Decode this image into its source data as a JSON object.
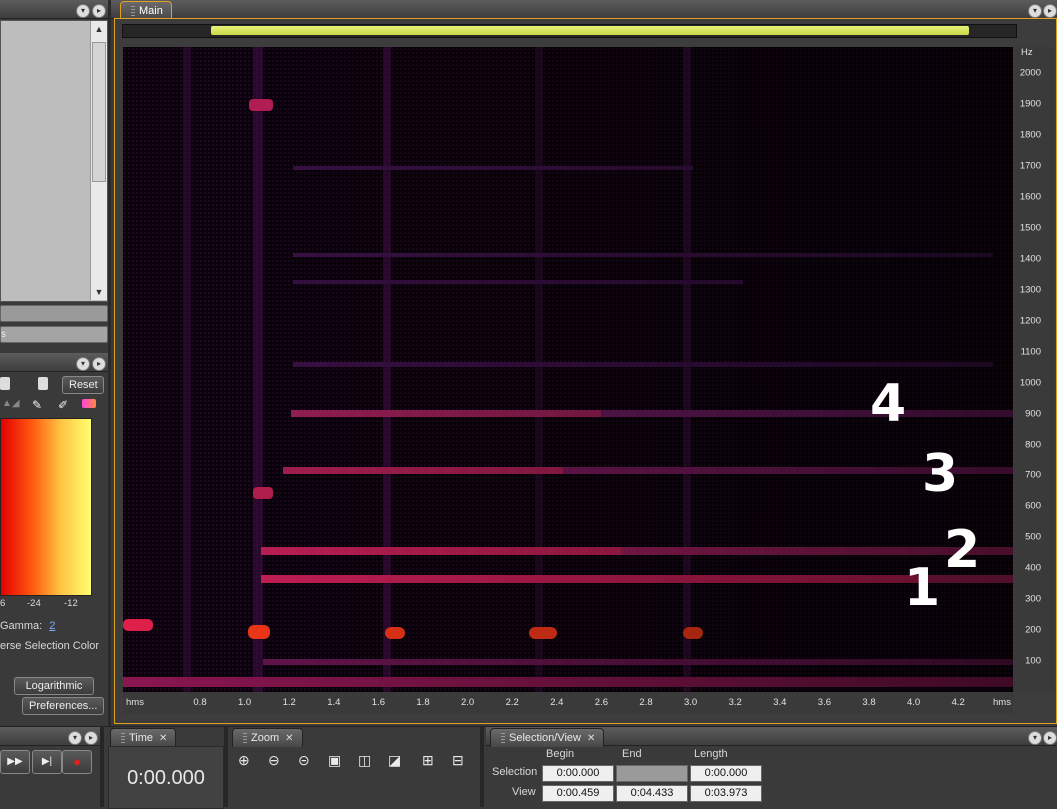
{
  "tabs": {
    "main": "Main",
    "time": "Time",
    "zoom": "Zoom",
    "selection_view": "Selection/View"
  },
  "left_panel": {
    "reset_label": "Reset",
    "db_ticks": [
      "6",
      "-24",
      "-12"
    ],
    "gamma_label": "Gamma:",
    "gamma_value": "2",
    "inverse_selection_label": "erse Selection Color",
    "logarithmic_label": "Logarithmic",
    "preferences_label": "Preferences...",
    "list_item_fragment": "s"
  },
  "spectrogram": {
    "hz_unit": "Hz",
    "hz_ticks": [
      "2000",
      "1900",
      "1800",
      "1700",
      "1600",
      "1500",
      "1400",
      "1300",
      "1200",
      "1100",
      "1000",
      "900",
      "800",
      "700",
      "600",
      "500",
      "400",
      "300",
      "200",
      "100"
    ],
    "hz_values": [
      2000,
      1900,
      1800,
      1700,
      1600,
      1500,
      1400,
      1300,
      1200,
      1100,
      1000,
      900,
      800,
      700,
      600,
      500,
      400,
      300,
      200,
      100
    ],
    "time_unit": "hms",
    "time_ticks": [
      "0.8",
      "1.0",
      "1.2",
      "1.4",
      "1.6",
      "1.8",
      "2.0",
      "2.2",
      "2.4",
      "2.6",
      "2.8",
      "3.0",
      "3.2",
      "3.4",
      "3.6",
      "3.8",
      "4.0",
      "4.2"
    ],
    "annotations": [
      "4",
      "3",
      "2",
      "1"
    ]
  },
  "time_panel": {
    "display": "0:00.000"
  },
  "selection_view": {
    "headers": [
      "Begin",
      "End",
      "Length"
    ],
    "selection_label": "Selection",
    "view_label": "View",
    "selection": [
      "0:00.000",
      "",
      "0:00.000"
    ],
    "view": [
      "0:00.459",
      "0:04.433",
      "0:03.973"
    ]
  },
  "colors": {
    "accent_border": "#e0a020",
    "scroll_highlight": "#d8e85a",
    "spectrogram_bg": "#0b020b",
    "band_color": "#d0205a"
  }
}
